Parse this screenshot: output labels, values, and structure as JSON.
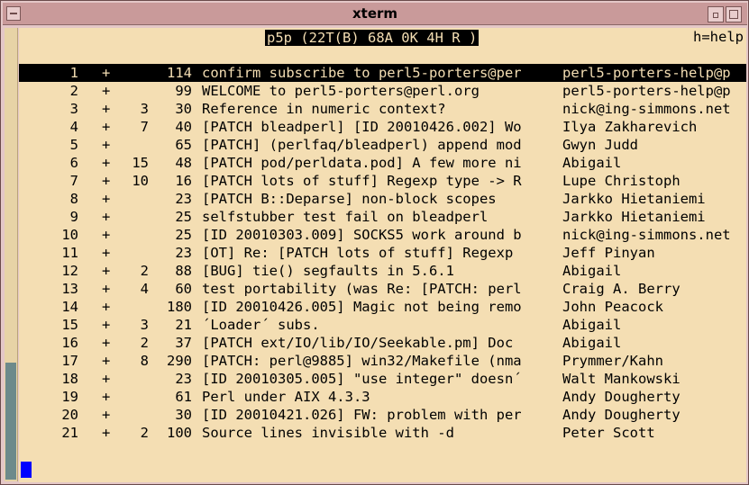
{
  "window": {
    "title": "xterm"
  },
  "status_line": {
    "text": "p5p (22T(B) 68A 0K 4H R )",
    "help": "h=help"
  },
  "messages": [
    {
      "num": "1",
      "flag": "+",
      "count": "",
      "size": "114",
      "subject": "confirm subscribe to perl5-porters@per",
      "from": "perl5-porters-help@p",
      "selected": true
    },
    {
      "num": "2",
      "flag": "+",
      "count": "",
      "size": "99",
      "subject": "WELCOME to perl5-porters@perl.org",
      "from": "perl5-porters-help@p"
    },
    {
      "num": "3",
      "flag": "+",
      "count": "3",
      "size": "30",
      "subject": "Reference in numeric context?",
      "from": "nick@ing-simmons.net"
    },
    {
      "num": "4",
      "flag": "+",
      "count": "7",
      "size": "40",
      "subject": "[PATCH bleadperl] [ID 20010426.002] Wo",
      "from": "Ilya Zakharevich"
    },
    {
      "num": "5",
      "flag": "+",
      "count": "",
      "size": "65",
      "subject": "[PATCH] (perlfaq/bleadperl) append mod",
      "from": "Gwyn Judd"
    },
    {
      "num": "6",
      "flag": "+",
      "count": "15",
      "size": "48",
      "subject": "[PATCH pod/perldata.pod] A few more ni",
      "from": "Abigail"
    },
    {
      "num": "7",
      "flag": "+",
      "count": "10",
      "size": "16",
      "subject": "[PATCH lots of stuff] Regexp type -> R",
      "from": "Lupe Christoph"
    },
    {
      "num": "8",
      "flag": "+",
      "count": "",
      "size": "23",
      "subject": "[PATCH B::Deparse] non-block scopes",
      "from": "Jarkko Hietaniemi"
    },
    {
      "num": "9",
      "flag": "+",
      "count": "",
      "size": "25",
      "subject": "selfstubber test fail on bleadperl",
      "from": "Jarkko Hietaniemi"
    },
    {
      "num": "10",
      "flag": "+",
      "count": "",
      "size": "25",
      "subject": "[ID 20010303.009] SOCKS5 work around b",
      "from": "nick@ing-simmons.net"
    },
    {
      "num": "11",
      "flag": "+",
      "count": "",
      "size": "23",
      "subject": "[OT] Re: [PATCH lots of stuff] Regexp",
      "from": "Jeff Pinyan"
    },
    {
      "num": "12",
      "flag": "+",
      "count": "2",
      "size": "88",
      "subject": "[BUG] tie() segfaults in 5.6.1",
      "from": "Abigail"
    },
    {
      "num": "13",
      "flag": "+",
      "count": "4",
      "size": "60",
      "subject": "test portability (was Re: [PATCH: perl",
      "from": "Craig A. Berry"
    },
    {
      "num": "14",
      "flag": "+",
      "count": "",
      "size": "180",
      "subject": "[ID 20010426.005] Magic not being remo",
      "from": "John Peacock"
    },
    {
      "num": "15",
      "flag": "+",
      "count": "3",
      "size": "21",
      "subject": "´Loader´ subs.",
      "from": "Abigail"
    },
    {
      "num": "16",
      "flag": "+",
      "count": "2",
      "size": "37",
      "subject": "[PATCH ext/IO/lib/IO/Seekable.pm] Doc",
      "from": "Abigail"
    },
    {
      "num": "17",
      "flag": "+",
      "count": "8",
      "size": "290",
      "subject": "[PATCH: perl@9885] win32/Makefile (nma",
      "from": "Prymmer/Kahn"
    },
    {
      "num": "18",
      "flag": "+",
      "count": "",
      "size": "23",
      "subject": "[ID 20010305.005] \"use integer\" doesn´",
      "from": "Walt Mankowski"
    },
    {
      "num": "19",
      "flag": "+",
      "count": "",
      "size": "61",
      "subject": "Perl under AIX 4.3.3",
      "from": "Andy Dougherty"
    },
    {
      "num": "20",
      "flag": "+",
      "count": "",
      "size": "30",
      "subject": "[ID 20010421.026] FW: problem with per",
      "from": "Andy Dougherty"
    },
    {
      "num": "21",
      "flag": "+",
      "count": "2",
      "size": "100",
      "subject": "Source lines invisible with -d",
      "from": "Peter Scott"
    }
  ]
}
